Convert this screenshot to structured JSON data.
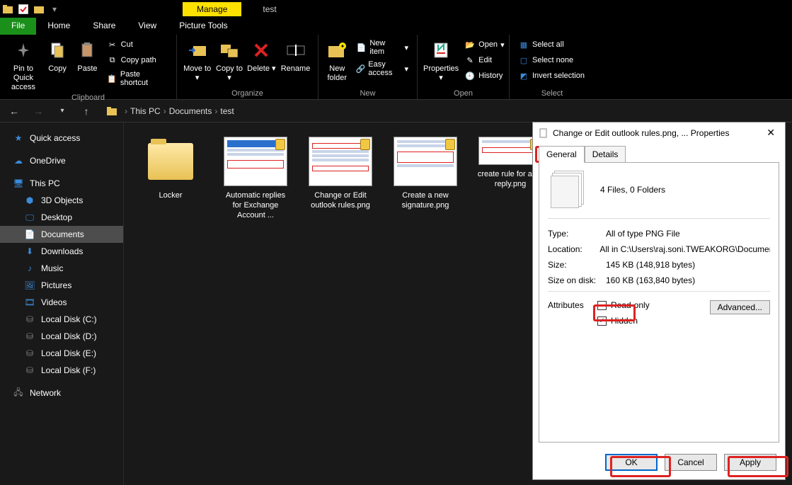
{
  "window": {
    "title": "test",
    "context_tab": "Manage"
  },
  "ribbon_tabs": {
    "file": "File",
    "home": "Home",
    "share": "Share",
    "view": "View",
    "picture_tools": "Picture Tools"
  },
  "ribbon": {
    "clipboard": {
      "label": "Clipboard",
      "pin": "Pin to Quick access",
      "copy": "Copy",
      "paste": "Paste",
      "cut": "Cut",
      "copypath": "Copy path",
      "pasteshortcut": "Paste shortcut"
    },
    "organize": {
      "label": "Organize",
      "moveto": "Move to",
      "copyto": "Copy to",
      "delete": "Delete",
      "rename": "Rename"
    },
    "new": {
      "label": "New",
      "newfolder": "New folder",
      "newitem": "New item",
      "easyaccess": "Easy access"
    },
    "open": {
      "label": "Open",
      "properties": "Properties",
      "open": "Open",
      "edit": "Edit",
      "history": "History"
    },
    "select": {
      "label": "Select",
      "selectall": "Select all",
      "selectnone": "Select none",
      "invert": "Invert selection"
    }
  },
  "crumbs": {
    "thispc": "This PC",
    "documents": "Documents",
    "test": "test"
  },
  "nav": {
    "quick": "Quick access",
    "onedrive": "OneDrive",
    "thispc": "This PC",
    "objects": "3D Objects",
    "desktop": "Desktop",
    "documents": "Documents",
    "downloads": "Downloads",
    "music": "Music",
    "pictures": "Pictures",
    "videos": "Videos",
    "c": "Local Disk (C:)",
    "d": "Local Disk (D:)",
    "e": "Local Disk (E:)",
    "f": "Local Disk (F:)",
    "network": "Network"
  },
  "files": {
    "f0": "Locker",
    "f1": "Automatic replies for Exchange Account ...",
    "f2": "Change or Edit outlook rules.png",
    "f3": "Create a new signature.png",
    "f4": "create rule for auto reply.png"
  },
  "dialog": {
    "title": "Change or Edit outlook rules.png, ... Properties",
    "tab_general": "General",
    "tab_details": "Details",
    "summary": "4 Files, 0 Folders",
    "type_k": "Type:",
    "type_v": "All of type PNG File",
    "loc_k": "Location:",
    "loc_v": "All in C:\\Users\\raj.soni.TWEAKORG\\Documents\\tes",
    "size_k": "Size:",
    "size_v": "145 KB (148,918 bytes)",
    "disk_k": "Size on disk:",
    "disk_v": "160 KB (163,840 bytes)",
    "attr_k": "Attributes",
    "readonly": "Read-only",
    "hidden": "Hidden",
    "advanced": "Advanced...",
    "ok": "OK",
    "cancel": "Cancel",
    "apply": "Apply"
  }
}
